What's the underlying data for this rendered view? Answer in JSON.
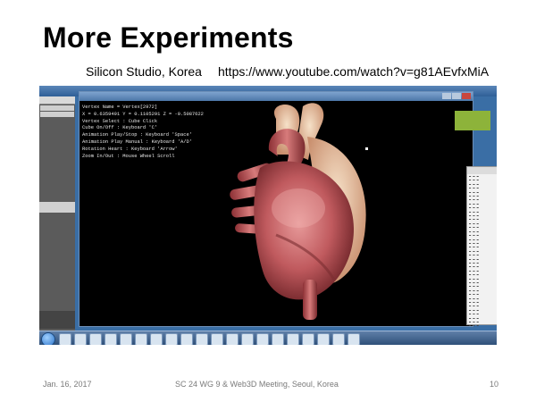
{
  "slide": {
    "title": "More Experiments",
    "company": "Silicon Studio, Korea",
    "url": "https://www.youtube.com/watch?v=g81AEvfxMiA",
    "footer_date": "Jan. 16, 2017",
    "footer_event": "SC 24 WG 9 & Web3D Meeting, Seoul, Korea",
    "page_number": "10",
    "accent_color": "#8db33a"
  },
  "app_window": {
    "overlay_lines": [
      "Vertex Name = Vertex[2972]",
      "X = 0.6359491 Y = 0.1105291 Z = -0.5087622",
      "Vertex Select : Cube Click",
      "Cube On/Off : Keyboard 'C'",
      "Animation Play/Stop : Keyboard 'Space'",
      "Animation Play Manual : Keyboard 'A/D'",
      "Rotation Heart : Keyboard 'Arrow'",
      "Zoom In/Out : Mouse Wheel Scroll"
    ],
    "heart_icon": "heart-model-icon"
  },
  "taskbar": {
    "icons": [
      "start-orb-icon",
      "ie-icon",
      "folder-icon",
      "media-icon",
      "app-icon-1",
      "app-icon-2",
      "app-icon-3",
      "steam-icon",
      "app-icon-4",
      "app-icon-5",
      "app-icon-6",
      "app-icon-7",
      "app-icon-8",
      "app-icon-9",
      "app-icon-10",
      "app-icon-11",
      "app-icon-12",
      "app-icon-13",
      "app-icon-14",
      "app-icon-15",
      "app-icon-16"
    ]
  }
}
